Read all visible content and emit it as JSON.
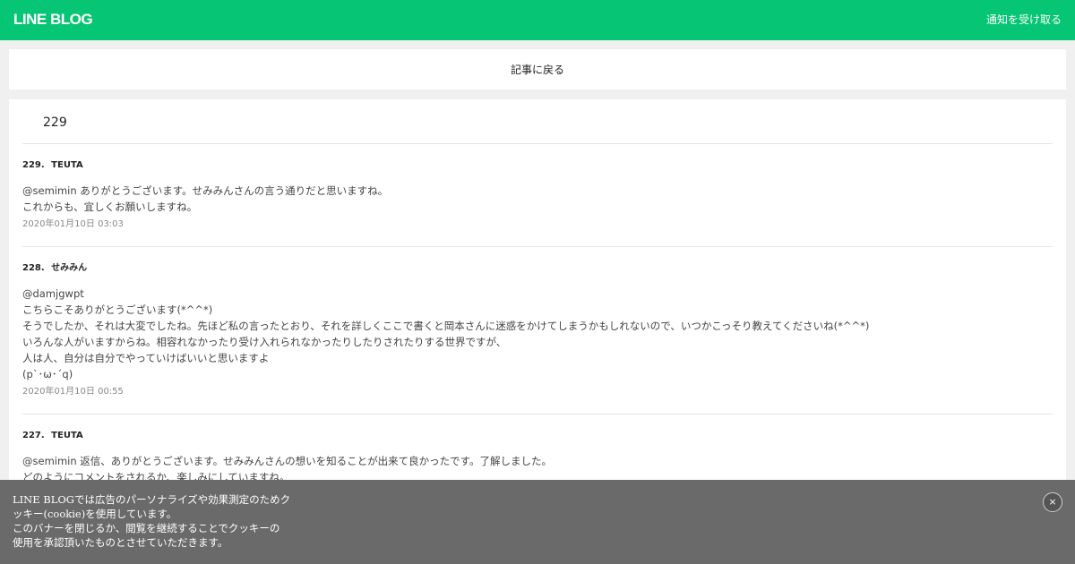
{
  "header": {
    "logo": "LINE BLOG",
    "notify_label": "通知を受け取る"
  },
  "back": {
    "label": "記事に戻る"
  },
  "comments_section": {
    "count": "229",
    "comments": [
      {
        "number": "229.",
        "author": "TEUTA",
        "lines": [
          "@semimin ありがとうございます。せみみんさんの言う通りだと思いますね。",
          "これからも、宜しくお願いしますね。"
        ],
        "date": "2020年01月10日 03:03"
      },
      {
        "number": "228.",
        "author": "せみみん",
        "lines": [
          "@damjgwpt",
          "こちらこそありがとうございます(*^^*)",
          "そうでしたか、それは大変でしたね。先ほど私の言ったとおり、それを詳しくここで書くと岡本さんに迷惑をかけてしまうかもしれないので、いつかこっそり教えてくださいね(*^^*)",
          "いろんな人がいますからね。相容れなかったり受け入れられなかったりしたりされたりする世界ですが、",
          "人は人、自分は自分でやっていけばいいと思いますよ",
          "(p`･ω･´q)"
        ],
        "date": "2020年01月10日 00:55"
      },
      {
        "number": "227.",
        "author": "TEUTA",
        "lines": [
          "@semimin 返信、ありがとうございます。せみみんさんの想いを知ることが出来て良かったです。了解しました。",
          "どのようにコメントをされるか、楽しみにしていますね。"
        ]
      }
    ]
  },
  "cookie_banner": {
    "lines": [
      "LINE BLOGでは広告のパーソナライズや効果測定のためク",
      "ッキー(cookie)を使用しています。",
      "このバナーを閉じるか、閲覧を継続することでクッキーの",
      "使用を承認頂いたものとさせていただきます。"
    ],
    "close_label": "×"
  },
  "colors": {
    "brand_green": "#06c574",
    "banner_gray": "#6a6a6a"
  }
}
